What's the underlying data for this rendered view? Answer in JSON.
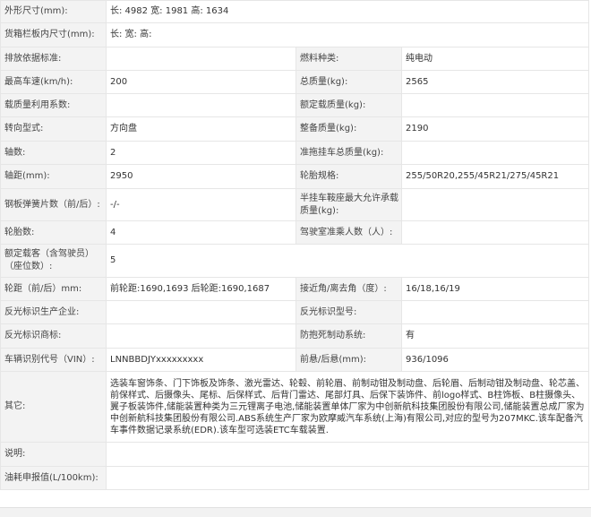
{
  "rows": [
    {
      "type": "wide",
      "label": "外形尺寸(mm):",
      "value": "长: 4982 宽: 1981 高: 1634"
    },
    {
      "type": "wide",
      "label": "货箱栏板内尺寸(mm):",
      "value": "长:  宽:  高:"
    },
    {
      "type": "pair",
      "label1": "排放依据标准:",
      "value1": "",
      "label2": "燃料种类:",
      "value2": "纯电动"
    },
    {
      "type": "pair",
      "label1": "最高车速(km/h):",
      "value1": "200",
      "label2": "总质量(kg):",
      "value2": "2565"
    },
    {
      "type": "pair",
      "label1": "载质量利用系数:",
      "value1": "",
      "label2": "额定载质量(kg):",
      "value2": ""
    },
    {
      "type": "pair",
      "label1": "转向型式:",
      "value1": "方向盘",
      "label2": "整备质量(kg):",
      "value2": "2190"
    },
    {
      "type": "pair",
      "label1": "轴数:",
      "value1": "2",
      "label2": "准拖挂车总质量(kg):",
      "value2": ""
    },
    {
      "type": "pair",
      "label1": "轴距(mm):",
      "value1": "2950",
      "label2": "轮胎规格:",
      "value2": "255/50R20,255/45R21/275/45R21"
    },
    {
      "type": "pair",
      "label1": "钢板弹簧片数（前/后）:",
      "value1": "-/-",
      "label2": "半挂车鞍座最大允许承载质量(kg):",
      "value2": ""
    },
    {
      "type": "pair",
      "label1": "轮胎数:",
      "value1": "4",
      "label2": "驾驶室准乘人数（人）:",
      "value2": ""
    },
    {
      "type": "wide",
      "label": "额定载客（含驾驶员）（座位数）:",
      "value": "5"
    },
    {
      "type": "pair",
      "label1": "轮距（前/后）mm:",
      "value1": "前轮距:1690,1693 后轮距:1690,1687",
      "label2": "接近角/离去角（度）:",
      "value2": "16/18,16/19"
    },
    {
      "type": "pair",
      "label1": "反光标识生产企业:",
      "value1": "",
      "label2": "反光标识型号:",
      "value2": ""
    },
    {
      "type": "pair",
      "label1": "反光标识商标:",
      "value1": "",
      "label2": "防抱死制动系统:",
      "value2": "有"
    },
    {
      "type": "pair",
      "label1": "车辆识别代号（VIN）:",
      "value1": "LNNBBDJYxxxxxxxxx",
      "label2": "前悬/后悬(mm):",
      "value2": "936/1096"
    },
    {
      "type": "other",
      "label": "其它:",
      "value": "选装车窗饰条、门下饰板及饰条、激光雷达、轮毂、前轮眉、前制动钳及制动盘、后轮眉、后制动钳及制动盘、轮芯盖、前保样式、后摄像头、尾标、后保样式、后背门雷达、尾部灯具、后保下装饰件、前logo样式、B柱饰板、B柱摄像头、翼子板装饰件,储能装置种类为三元锂离子电池,储能装置单体厂家为中创新航科技集团股份有限公司,储能装置总成厂家为中创新航科技集团股份有限公司.ABS系统生产厂家为欧摩威汽车系统(上海)有限公司,对应的型号为207MKC.该车配备汽车事件数据记录系统(EDR).该车型可选装ETC车载装置."
    },
    {
      "type": "wide",
      "label": "说明:",
      "value": ""
    },
    {
      "type": "wide",
      "label": "油耗申报值(L/100km):",
      "value": ""
    }
  ]
}
